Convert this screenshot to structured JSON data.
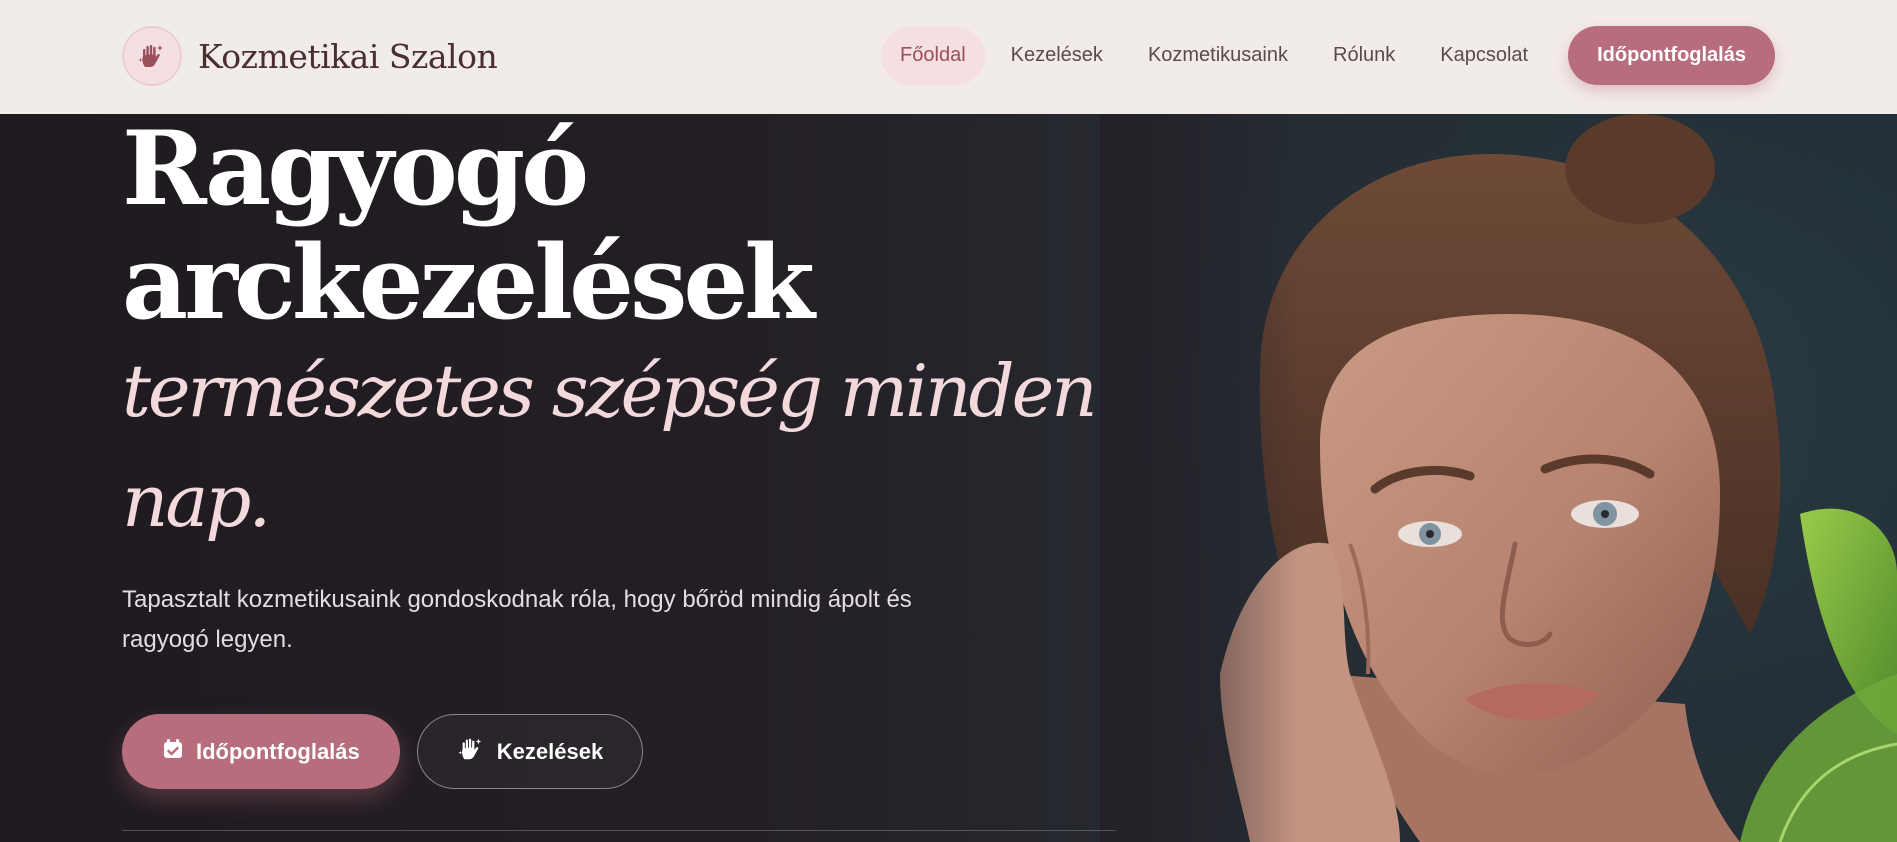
{
  "brand": {
    "name": "Kozmetikai Szalon",
    "logo_icon": "hand-sparkles-icon"
  },
  "nav": {
    "items": [
      {
        "label": "Főoldal",
        "active": true
      },
      {
        "label": "Kezelések",
        "active": false
      },
      {
        "label": "Kozmetikusaink",
        "active": false
      },
      {
        "label": "Rólunk",
        "active": false
      },
      {
        "label": "Kapcsolat",
        "active": false
      }
    ],
    "cta_label": "Időpontfoglalás"
  },
  "hero": {
    "title_line1": "Ragyogó",
    "title_line2": "arckezelések",
    "subtitle": "természetes szépség minden nap.",
    "lead": "Tapasztalt kozmetikusaink gondoskodnak róla, hogy bőröd mindig ápolt és ragyogó legyen.",
    "primary_button": {
      "label": "Időpontfoglalás",
      "icon": "calendar-check-icon"
    },
    "secondary_button": {
      "label": "Kezelések",
      "icon": "hand-sparkles-icon"
    }
  },
  "colors": {
    "accent": "#b76d7c",
    "accent_light": "#f5dfe1",
    "header_bg": "#f2ece9",
    "hero_bg": "#1e1a1f",
    "subtitle": "#f3d9dc"
  }
}
